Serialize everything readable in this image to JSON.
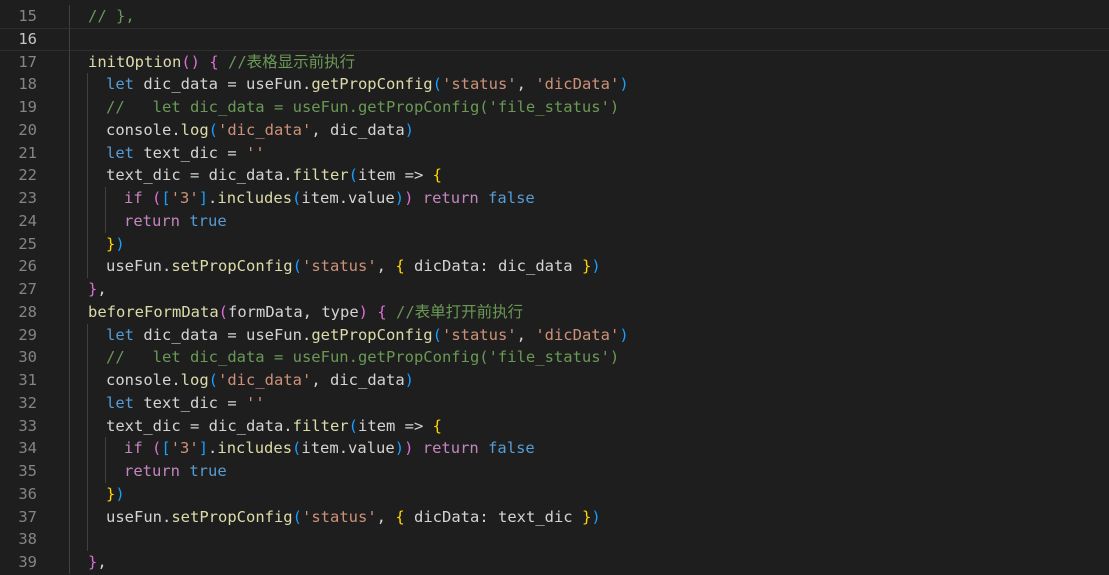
{
  "editor": {
    "language": "javascript",
    "theme": "dark",
    "active_line": 16,
    "lines": [
      {
        "n": "15",
        "indent": 1,
        "tokens": [
          {
            "t": "// },",
            "c": "cm"
          }
        ]
      },
      {
        "n": "16",
        "indent": 1,
        "tokens": []
      },
      {
        "n": "17",
        "indent": 1,
        "tokens": [
          {
            "t": "initOption",
            "c": "fn"
          },
          {
            "t": "()",
            "c": "b2"
          },
          {
            "t": " ",
            "c": "pl"
          },
          {
            "t": "{",
            "c": "b2"
          },
          {
            "t": " //表格显示前执行",
            "c": "cm"
          }
        ]
      },
      {
        "n": "18",
        "indent": 2,
        "tokens": [
          {
            "t": "let",
            "c": "kw"
          },
          {
            "t": " dic_data = useFun.",
            "c": "pl"
          },
          {
            "t": "getPropConfig",
            "c": "fn"
          },
          {
            "t": "(",
            "c": "b3"
          },
          {
            "t": "'status'",
            "c": "str"
          },
          {
            "t": ", ",
            "c": "pl"
          },
          {
            "t": "'dicData'",
            "c": "str"
          },
          {
            "t": ")",
            "c": "b3"
          }
        ]
      },
      {
        "n": "19",
        "indent": 2,
        "tokens": [
          {
            "t": "//   let dic_data = useFun.getPropConfig('file_status')",
            "c": "cm"
          }
        ]
      },
      {
        "n": "20",
        "indent": 2,
        "tokens": [
          {
            "t": "console.",
            "c": "pl"
          },
          {
            "t": "log",
            "c": "fn"
          },
          {
            "t": "(",
            "c": "b3"
          },
          {
            "t": "'dic_data'",
            "c": "str"
          },
          {
            "t": ", dic_data",
            "c": "pl"
          },
          {
            "t": ")",
            "c": "b3"
          }
        ]
      },
      {
        "n": "21",
        "indent": 2,
        "tokens": [
          {
            "t": "let",
            "c": "kw"
          },
          {
            "t": " text_dic = ",
            "c": "pl"
          },
          {
            "t": "''",
            "c": "str"
          }
        ]
      },
      {
        "n": "22",
        "indent": 2,
        "tokens": [
          {
            "t": "text_dic = dic_data.",
            "c": "pl"
          },
          {
            "t": "filter",
            "c": "fn"
          },
          {
            "t": "(",
            "c": "b3"
          },
          {
            "t": "item => ",
            "c": "pl"
          },
          {
            "t": "{",
            "c": "b1"
          }
        ]
      },
      {
        "n": "23",
        "indent": 3,
        "tokens": [
          {
            "t": "if",
            "c": "ctl"
          },
          {
            "t": " ",
            "c": "pl"
          },
          {
            "t": "(",
            "c": "b2"
          },
          {
            "t": "[",
            "c": "b3"
          },
          {
            "t": "'3'",
            "c": "str"
          },
          {
            "t": "]",
            "c": "b3"
          },
          {
            "t": ".",
            "c": "pl"
          },
          {
            "t": "includes",
            "c": "fn"
          },
          {
            "t": "(",
            "c": "b3"
          },
          {
            "t": "item.value",
            "c": "pl"
          },
          {
            "t": ")",
            "c": "b3"
          },
          {
            "t": ")",
            "c": "b2"
          },
          {
            "t": " ",
            "c": "pl"
          },
          {
            "t": "return",
            "c": "ctl"
          },
          {
            "t": " ",
            "c": "pl"
          },
          {
            "t": "false",
            "c": "kw"
          }
        ]
      },
      {
        "n": "24",
        "indent": 3,
        "tokens": [
          {
            "t": "return",
            "c": "ctl"
          },
          {
            "t": " ",
            "c": "pl"
          },
          {
            "t": "true",
            "c": "kw"
          }
        ]
      },
      {
        "n": "25",
        "indent": 2,
        "tokens": [
          {
            "t": "}",
            "c": "b1"
          },
          {
            "t": ")",
            "c": "b3"
          }
        ]
      },
      {
        "n": "26",
        "indent": 2,
        "tokens": [
          {
            "t": "useFun.",
            "c": "pl"
          },
          {
            "t": "setPropConfig",
            "c": "fn"
          },
          {
            "t": "(",
            "c": "b3"
          },
          {
            "t": "'status'",
            "c": "str"
          },
          {
            "t": ", ",
            "c": "pl"
          },
          {
            "t": "{",
            "c": "b1"
          },
          {
            "t": " dicData: dic_data ",
            "c": "pl"
          },
          {
            "t": "}",
            "c": "b1"
          },
          {
            "t": ")",
            "c": "b3"
          }
        ]
      },
      {
        "n": "27",
        "indent": 1,
        "tokens": [
          {
            "t": "}",
            "c": "b2"
          },
          {
            "t": ",",
            "c": "pl"
          }
        ]
      },
      {
        "n": "28",
        "indent": 1,
        "tokens": [
          {
            "t": "beforeFormData",
            "c": "fn"
          },
          {
            "t": "(",
            "c": "b2"
          },
          {
            "t": "formData, type",
            "c": "pl"
          },
          {
            "t": ")",
            "c": "b2"
          },
          {
            "t": " ",
            "c": "pl"
          },
          {
            "t": "{",
            "c": "b2"
          },
          {
            "t": " //表单打开前执行",
            "c": "cm"
          }
        ]
      },
      {
        "n": "29",
        "indent": 2,
        "tokens": [
          {
            "t": "let",
            "c": "kw"
          },
          {
            "t": " dic_data = useFun.",
            "c": "pl"
          },
          {
            "t": "getPropConfig",
            "c": "fn"
          },
          {
            "t": "(",
            "c": "b3"
          },
          {
            "t": "'status'",
            "c": "str"
          },
          {
            "t": ", ",
            "c": "pl"
          },
          {
            "t": "'dicData'",
            "c": "str"
          },
          {
            "t": ")",
            "c": "b3"
          }
        ]
      },
      {
        "n": "30",
        "indent": 2,
        "tokens": [
          {
            "t": "//   let dic_data = useFun.getPropConfig('file_status')",
            "c": "cm"
          }
        ]
      },
      {
        "n": "31",
        "indent": 2,
        "tokens": [
          {
            "t": "console.",
            "c": "pl"
          },
          {
            "t": "log",
            "c": "fn"
          },
          {
            "t": "(",
            "c": "b3"
          },
          {
            "t": "'dic_data'",
            "c": "str"
          },
          {
            "t": ", dic_data",
            "c": "pl"
          },
          {
            "t": ")",
            "c": "b3"
          }
        ]
      },
      {
        "n": "32",
        "indent": 2,
        "tokens": [
          {
            "t": "let",
            "c": "kw"
          },
          {
            "t": " text_dic = ",
            "c": "pl"
          },
          {
            "t": "''",
            "c": "str"
          }
        ]
      },
      {
        "n": "33",
        "indent": 2,
        "tokens": [
          {
            "t": "text_dic = dic_data.",
            "c": "pl"
          },
          {
            "t": "filter",
            "c": "fn"
          },
          {
            "t": "(",
            "c": "b3"
          },
          {
            "t": "item => ",
            "c": "pl"
          },
          {
            "t": "{",
            "c": "b1"
          }
        ]
      },
      {
        "n": "34",
        "indent": 3,
        "tokens": [
          {
            "t": "if",
            "c": "ctl"
          },
          {
            "t": " ",
            "c": "pl"
          },
          {
            "t": "(",
            "c": "b2"
          },
          {
            "t": "[",
            "c": "b3"
          },
          {
            "t": "'3'",
            "c": "str"
          },
          {
            "t": "]",
            "c": "b3"
          },
          {
            "t": ".",
            "c": "pl"
          },
          {
            "t": "includes",
            "c": "fn"
          },
          {
            "t": "(",
            "c": "b3"
          },
          {
            "t": "item.value",
            "c": "pl"
          },
          {
            "t": ")",
            "c": "b3"
          },
          {
            "t": ")",
            "c": "b2"
          },
          {
            "t": " ",
            "c": "pl"
          },
          {
            "t": "return",
            "c": "ctl"
          },
          {
            "t": " ",
            "c": "pl"
          },
          {
            "t": "false",
            "c": "kw"
          }
        ]
      },
      {
        "n": "35",
        "indent": 3,
        "tokens": [
          {
            "t": "return",
            "c": "ctl"
          },
          {
            "t": " ",
            "c": "pl"
          },
          {
            "t": "true",
            "c": "kw"
          }
        ]
      },
      {
        "n": "36",
        "indent": 2,
        "tokens": [
          {
            "t": "}",
            "c": "b1"
          },
          {
            "t": ")",
            "c": "b3"
          }
        ]
      },
      {
        "n": "37",
        "indent": 2,
        "tokens": [
          {
            "t": "useFun.",
            "c": "pl"
          },
          {
            "t": "setPropConfig",
            "c": "fn"
          },
          {
            "t": "(",
            "c": "b3"
          },
          {
            "t": "'status'",
            "c": "str"
          },
          {
            "t": ", ",
            "c": "pl"
          },
          {
            "t": "{",
            "c": "b1"
          },
          {
            "t": " dicData: text_dic ",
            "c": "pl"
          },
          {
            "t": "}",
            "c": "b1"
          },
          {
            "t": ")",
            "c": "b3"
          }
        ]
      },
      {
        "n": "38",
        "indent": 2,
        "tokens": []
      },
      {
        "n": "39",
        "indent": 1,
        "tokens": [
          {
            "t": "}",
            "c": "b2"
          },
          {
            "t": ",",
            "c": "pl"
          }
        ]
      }
    ]
  },
  "colors": {
    "background": "#1e1e1e",
    "line_number": "#858585",
    "keyword": "#569cd6",
    "control": "#c586c0",
    "function": "#dcdcaa",
    "string": "#ce9178",
    "comment": "#6a9955",
    "bracket_1": "#ffd700",
    "bracket_2": "#da70d6",
    "bracket_3": "#179fff"
  }
}
